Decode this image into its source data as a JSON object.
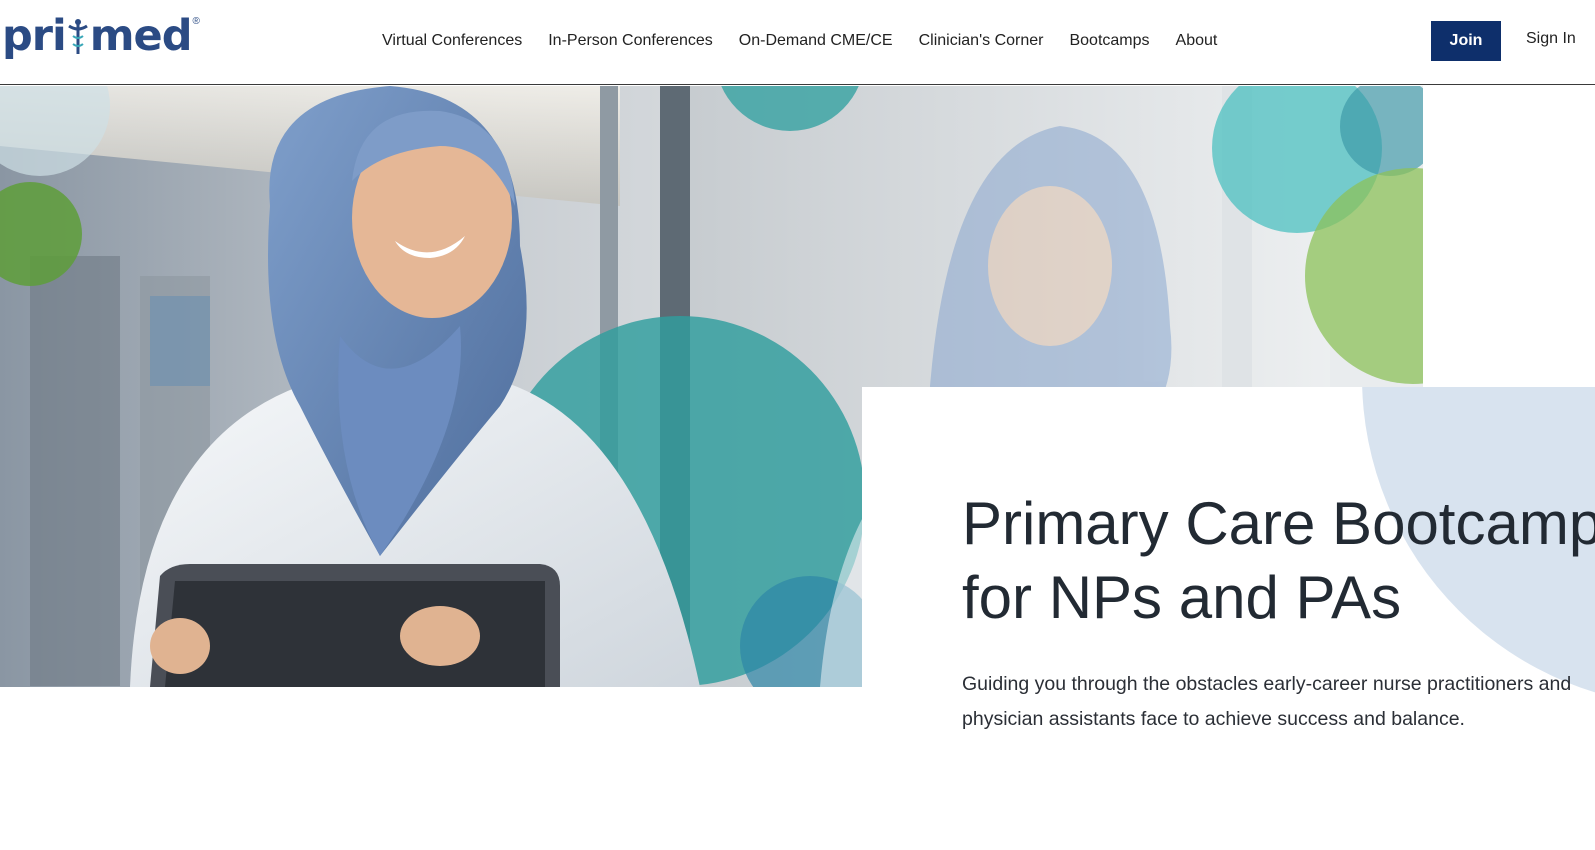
{
  "brand": {
    "logo_text_left": "pri",
    "logo_text_right": "med",
    "logo_registered": "®",
    "primary_color": "#0e2f6b",
    "logo_color": "#2b4b84"
  },
  "nav": {
    "items": [
      {
        "label": "Virtual Conferences"
      },
      {
        "label": "In-Person Conferences"
      },
      {
        "label": "On-Demand CME/CE"
      },
      {
        "label": "Clinician's Corner"
      },
      {
        "label": "Bootcamps"
      },
      {
        "label": "About"
      }
    ],
    "join_label": "Join",
    "signin_label": "Sign In"
  },
  "hero": {
    "title_line1": "Primary Care Bootcamp",
    "title_line2": "for NPs and PAs",
    "subtitle": "Guiding you through the obstacles early-career nurse practitioners and physician assistants face to achieve success and balance.",
    "image_icon": "clinician-photo",
    "accent_colors": {
      "teal": "#3fb3b3",
      "green": "#7cc04b",
      "light_blue": "#d8e3ef"
    }
  }
}
